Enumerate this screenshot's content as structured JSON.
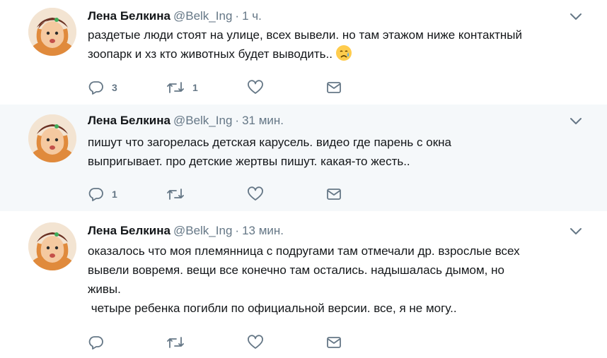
{
  "tweets": [
    {
      "name": "Лена Белкина",
      "handle": "@Belk_Ing",
      "separator": "·",
      "time": "1 ч.",
      "text": "раздетые люди стоят на улице, всех вывели. но там этажом ниже контактный\nзоопарк и хз кто животных будет выводить..",
      "emoji": "sad-tear-emoji",
      "reply_count": "3",
      "retweet_count": "1",
      "like_count": ""
    },
    {
      "name": "Лена Белкина",
      "handle": "@Belk_Ing",
      "separator": "·",
      "time": "31 мин.",
      "text": "пишут что загорелась детская карусель. видео где парень с окна\nвыпригывает. про детские жертвы пишут. какая-то жесть..",
      "reply_count": "1",
      "retweet_count": "",
      "like_count": ""
    },
    {
      "name": "Лена Белкина",
      "handle": "@Belk_Ing",
      "separator": "·",
      "time": "13 мин.",
      "text": "оказалось что моя племянница с подругами там отмечали др. взрослые всех\nвывели вовремя. вещи все конечно там остались. надышалась дымом, но\nживы.\n четыре ребенка погибли по официальной версии. все, я не могу..",
      "reply_count": "",
      "retweet_count": "",
      "like_count": ""
    }
  ],
  "icons": {
    "reply": "reply-icon",
    "retweet": "retweet-icon",
    "like": "heart-icon",
    "dm": "envelope-icon",
    "caret": "chevron-down-icon",
    "avatar": "avatar"
  },
  "colors": {
    "icon_gray": "#657786",
    "thread_line": "#c4e4f9",
    "hover_bg": "#f5f8fa"
  }
}
